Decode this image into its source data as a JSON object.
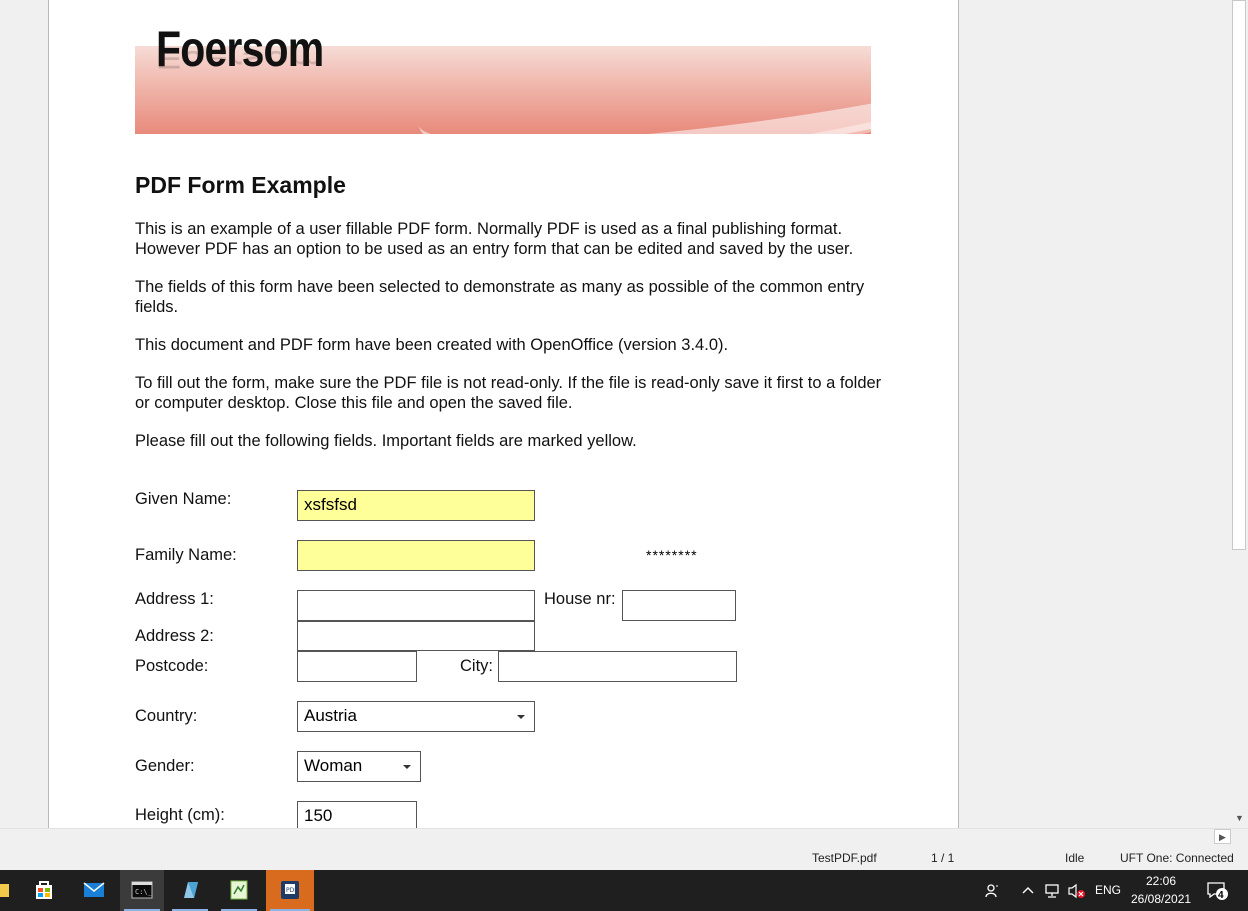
{
  "document": {
    "logo_text": "Foersom",
    "title": "PDF Form Example",
    "paragraphs": [
      "This is an example of a user fillable PDF form. Normally PDF is used as a final publishing format. However PDF has an option to be used as an entry form that can be edited and saved by the user.",
      "The fields of this form have been selected to demonstrate as many as possible of the common entry fields.",
      "This document and PDF form have been created with OpenOffice (version 3.4.0).",
      "To fill out the form, make sure the PDF file is not read-only. If the file is read-only save it first to a folder or computer desktop. Close this file and open the saved file.",
      "Please fill out the following fields. Important fields are marked yellow."
    ]
  },
  "form": {
    "given_name": {
      "label": "Given Name:",
      "value": "xsfsfsd"
    },
    "family_name": {
      "label": "Family Name:",
      "value": ""
    },
    "password_mask": "********",
    "address1": {
      "label": "Address 1:",
      "value": ""
    },
    "house_nr": {
      "label": "House nr:",
      "value": ""
    },
    "address2": {
      "label": "Address 2:",
      "value": ""
    },
    "postcode": {
      "label": "Postcode:",
      "value": ""
    },
    "city": {
      "label": "City:",
      "value": ""
    },
    "country": {
      "label": "Country:",
      "value": "Austria"
    },
    "gender": {
      "label": "Gender:",
      "value": "Woman"
    },
    "height": {
      "label": "Height (cm):",
      "value": "150"
    }
  },
  "statusbar": {
    "filename": "TestPDF.pdf",
    "page": "1 / 1",
    "state": "Idle",
    "uft": "UFT One: Connected"
  },
  "taskbar": {
    "language": "ENG",
    "time": "22:06",
    "date": "26/08/2021",
    "notifications": "4",
    "apps": [
      "file-explorer-icon",
      "store-icon",
      "mail-icon",
      "terminal-icon",
      "app-icon",
      "editor-icon",
      "pdf-viewer-icon"
    ]
  },
  "colors": {
    "required_field": "#ffff99",
    "taskbar_bg": "#1f1f1f",
    "active_app": "#d86b1e"
  }
}
